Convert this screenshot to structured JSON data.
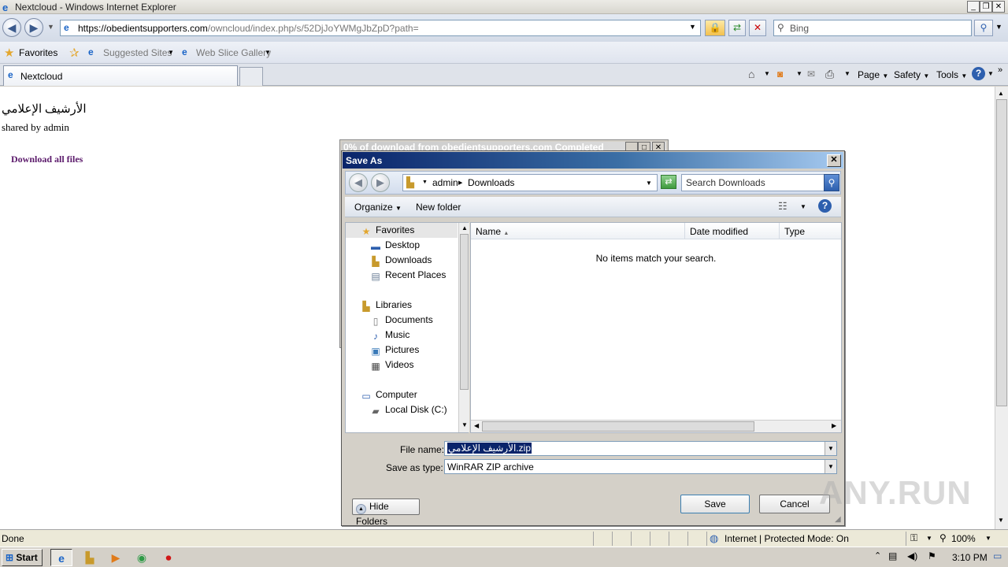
{
  "browser": {
    "window_title": "Nextcloud - Windows Internet Explorer",
    "address_main": "https://obedientsupporters.com",
    "address_rest": "/owncloud/index.php/s/52DjJoYWMgJbZpD?path=",
    "search_placeholder": "Bing",
    "favorites_label": "Favorites",
    "suggested_sites": "Suggested Sites",
    "web_slice_gallery": "Web Slice Gallery",
    "tab_title": "Nextcloud",
    "command_bar": {
      "page": "Page",
      "safety": "Safety",
      "tools": "Tools"
    }
  },
  "page": {
    "title": "الأرشيف الإعلامي",
    "shared_by": "shared by admin",
    "download_link": "Download all files"
  },
  "download_dialog": {
    "title": "0% of download from obedientsupporters.com Completed"
  },
  "save_as": {
    "title": "Save As",
    "breadcrumb": [
      "admin",
      "Downloads"
    ],
    "search_placeholder": "Search Downloads",
    "toolbar": {
      "organize": "Organize",
      "new_folder": "New folder"
    },
    "nav_tree": [
      {
        "label": "Favorites",
        "icon": "star-icon",
        "indent": 0
      },
      {
        "label": "Desktop",
        "icon": "desktop-icon",
        "indent": 1
      },
      {
        "label": "Downloads",
        "icon": "downloads-folder-icon",
        "indent": 1
      },
      {
        "label": "Recent Places",
        "icon": "recent-places-icon",
        "indent": 1
      },
      {
        "label": "Libraries",
        "icon": "libraries-icon",
        "indent": 0
      },
      {
        "label": "Documents",
        "icon": "documents-icon",
        "indent": 1
      },
      {
        "label": "Music",
        "icon": "music-icon",
        "indent": 1
      },
      {
        "label": "Pictures",
        "icon": "pictures-icon",
        "indent": 1
      },
      {
        "label": "Videos",
        "icon": "videos-icon",
        "indent": 1
      },
      {
        "label": "Computer",
        "icon": "computer-icon",
        "indent": 0
      },
      {
        "label": "Local Disk (C:)",
        "icon": "disk-icon",
        "indent": 1
      }
    ],
    "columns": [
      "Name",
      "Date modified",
      "Type"
    ],
    "empty_message": "No items match your search.",
    "file_name_label": "File name:",
    "file_name_value": "الأرشيف الإعلامي.zip",
    "save_type_label": "Save as type:",
    "save_type_value": "WinRAR ZIP archive",
    "hide_folders": "Hide Folders",
    "save_button": "Save",
    "cancel_button": "Cancel"
  },
  "status_bar": {
    "status": "Done",
    "zone": "Internet | Protected Mode: On",
    "zoom": "100%"
  },
  "taskbar": {
    "start": "Start",
    "clock": "3:10 PM"
  },
  "watermark": "ANY.RUN"
}
